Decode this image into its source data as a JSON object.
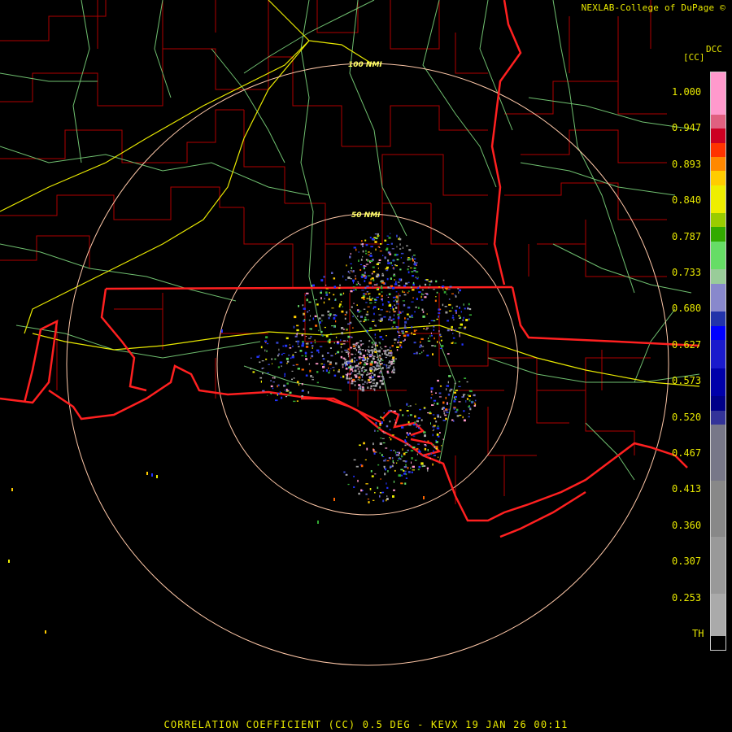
{
  "header": {
    "credit": "NEXLAB-College of DuPage ©",
    "station_code": "DCC",
    "units": "[CC]"
  },
  "range_rings": {
    "inner_label": "50 NMI",
    "outer_label": "100 NMI"
  },
  "legend": {
    "labels": [
      "1.000",
      "0.947",
      "0.893",
      "0.840",
      "0.787",
      "0.733",
      "0.680",
      "0.627",
      "0.573",
      "0.520",
      "0.467",
      "0.413",
      "0.360",
      "0.307",
      "0.253",
      "TH"
    ],
    "colors": [
      "#ff99cc",
      "#e06080",
      "#cc0022",
      "#ff3300",
      "#ff8800",
      "#ffcc00",
      "#eeee00",
      "#99cc00",
      "#33aa00",
      "#66dd66",
      "#99cc99",
      "#8888cc",
      "#2233aa",
      "#0000ff",
      "#1a1acc",
      "#0000aa",
      "#000088",
      "#333399",
      "#777788",
      "#888888",
      "#999999",
      "#aaaaaa",
      "#000000"
    ]
  },
  "footer": {
    "caption": "CORRELATION COEFFICIENT (CC) 0.5 DEG - KEVX 19 JAN 26 00:11"
  },
  "map_colors": {
    "state_border": "#ff2020",
    "county_border": "#cc0000",
    "coastline": "#ff2020",
    "highway": "#7ec87e",
    "interstate": "#e8e800",
    "range_ring": "#ffc0a0"
  }
}
